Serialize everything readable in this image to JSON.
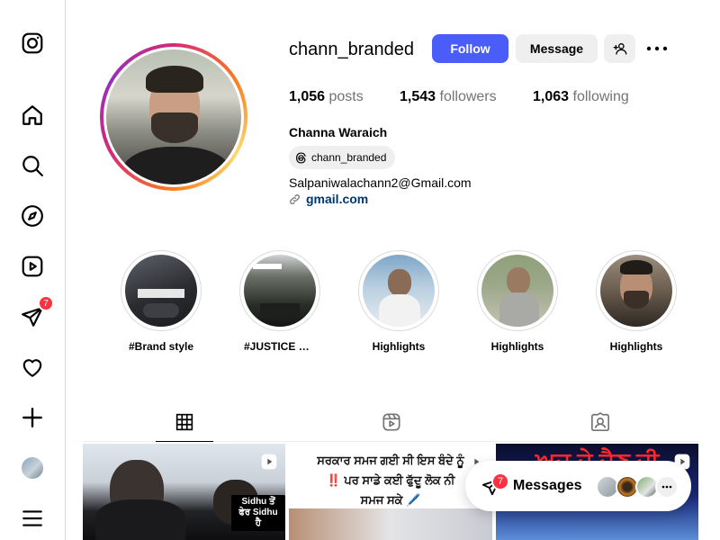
{
  "nav": {
    "items": [
      {
        "name": "instagram-logo-icon"
      },
      {
        "name": "home-icon"
      },
      {
        "name": "search-icon"
      },
      {
        "name": "explore-icon"
      },
      {
        "name": "reels-icon"
      },
      {
        "name": "messages-icon",
        "badge": "7"
      },
      {
        "name": "notifications-icon"
      },
      {
        "name": "create-icon"
      },
      {
        "name": "profile-avatar"
      },
      {
        "name": "menu-icon"
      }
    ]
  },
  "profile": {
    "username": "chann_branded",
    "follow_label": "Follow",
    "message_label": "Message",
    "stats": {
      "posts_count": "1,056",
      "posts_label": "posts",
      "followers_count": "1,543",
      "followers_label": "followers",
      "following_count": "1,063",
      "following_label": "following"
    },
    "full_name": "Channa Waraich",
    "threads_handle": "chann_branded",
    "bio_email": "Salpaniwalachann2@Gmail.com",
    "link_text": "gmail.com"
  },
  "highlights": [
    {
      "label": "#Brand style"
    },
    {
      "label": "#JUSTICE FOR..."
    },
    {
      "label": "Highlights"
    },
    {
      "label": "Highlights"
    },
    {
      "label": "Highlights"
    }
  ],
  "posts": [
    {
      "overlay_text_1": "Sidhu ਤੋਂ",
      "overlay_text_2": "ਫੇਰ Sidhu ਹੈ"
    },
    {
      "caption_line_1": "ਸਰਕਾਰ ਸਮਜ ਗਈ ਸੀ ਇਸ ਬੰਦੇ ਨੂੰ",
      "caption_line_2": "‼️ ਪਰ ਸਾਡੇ ਕਈ ਫੁੱਦੂ ਲੋਕ ਨੀ",
      "caption_line_3": "ਸਮਜ ਸਕੇ 🖊️"
    },
    {
      "caption": "ਅਜ ਦੇ ਦੈਣ ਦੀ"
    }
  ],
  "messages_pill": {
    "label": "Messages",
    "badge": "7"
  },
  "colors": {
    "accent": "#4a5df9",
    "badge": "#ff3040",
    "link": "#00376b"
  }
}
